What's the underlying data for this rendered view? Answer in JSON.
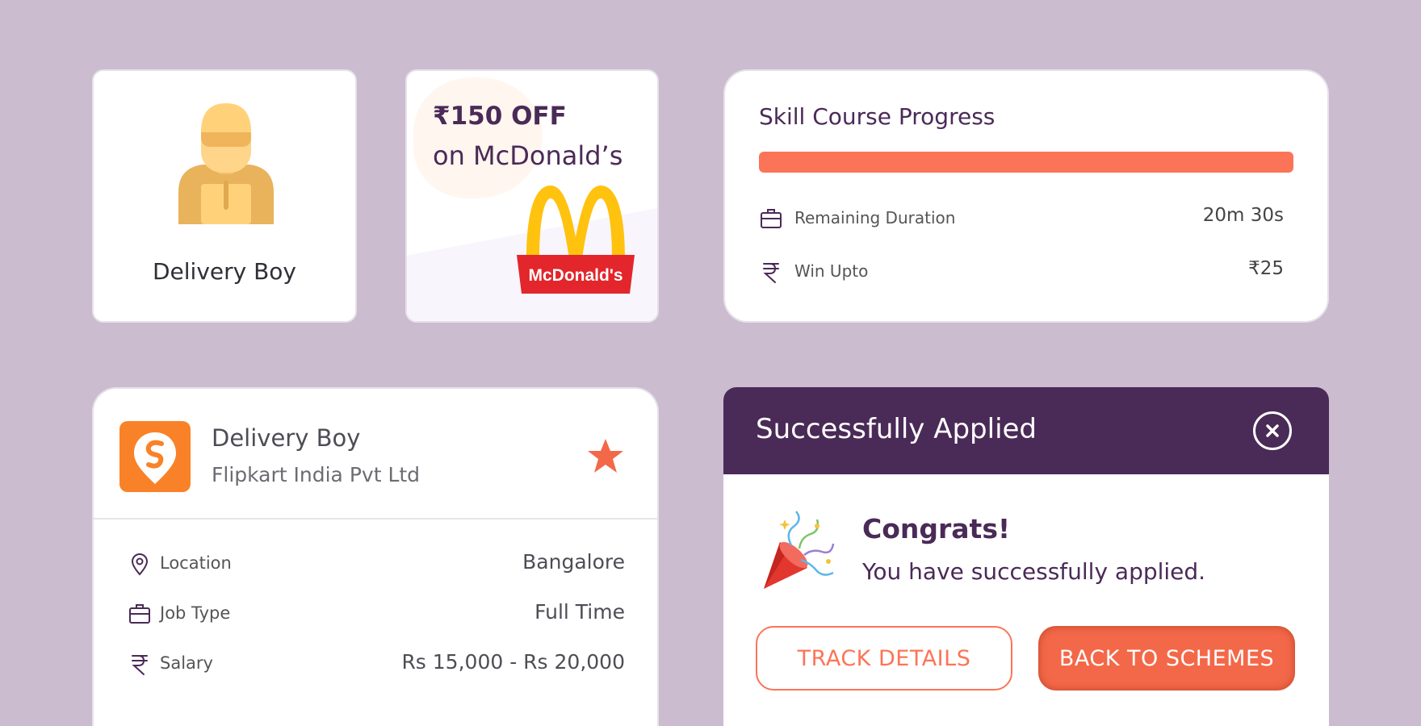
{
  "profile_card": {
    "title": "Delivery Boy",
    "icon": "delivery-person-icon"
  },
  "offer_card": {
    "amount": "₹150 OFF",
    "line2": "on McDonald’s",
    "brand_logo_text": "McDonald's"
  },
  "progress_card": {
    "title": "Skill Course Progress",
    "progress_fraction": 1.0,
    "rows": [
      {
        "icon": "briefcase-icon",
        "label": "Remaining Duration",
        "value": "20m 30s"
      },
      {
        "icon": "rupee-icon",
        "label": "Win Upto",
        "value": "₹25"
      }
    ]
  },
  "job_card": {
    "company_logo_icon": "swiggy-logo-icon",
    "title": "Delivery Boy",
    "company": "Flipkart India Pvt Ltd",
    "favorite_icon": "star-icon",
    "details": [
      {
        "icon": "location-pin-icon",
        "label": "Location",
        "value": "Bangalore"
      },
      {
        "icon": "briefcase-icon",
        "label": "Job Type",
        "value": "Full Time"
      },
      {
        "icon": "rupee-icon",
        "label": "Salary",
        "value": "Rs 15,000 - Rs 20,000"
      }
    ]
  },
  "success_modal": {
    "title": "Successfully Applied",
    "close_icon": "close-icon",
    "celebration_icon": "party-popper-icon",
    "heading": "Congrats!",
    "message": "You have successfully applied.",
    "track_button": "TRACK DETAILS",
    "back_button": "BACK TO SCHEMES"
  },
  "colors": {
    "background": "#cbbcd0",
    "primary_purple": "#4a2a57",
    "accent_orange": "#fc7457",
    "swiggy_orange": "#f98228",
    "mcdonalds_red": "#e2262c",
    "mcdonalds_yellow": "#ffc20e"
  }
}
